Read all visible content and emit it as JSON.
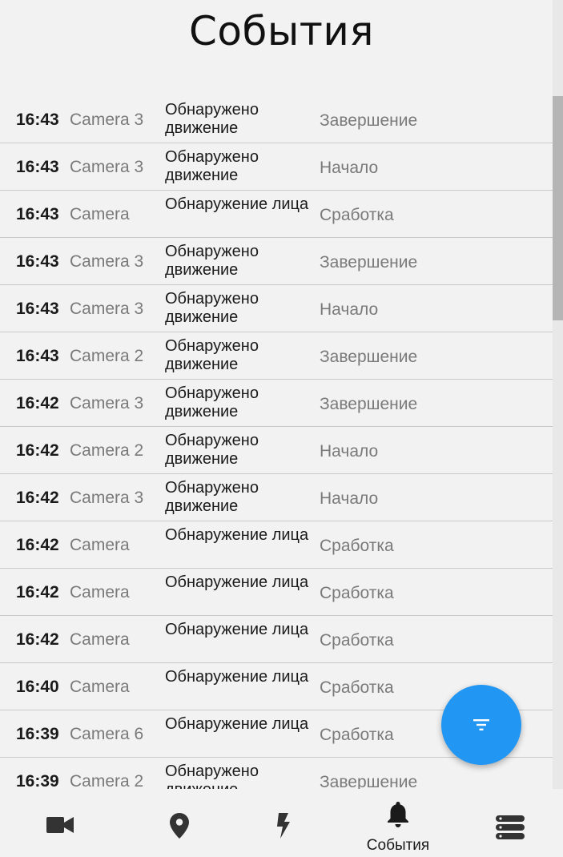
{
  "page": {
    "title": "События"
  },
  "events": [
    {
      "time": "16:43",
      "camera": "Camera 3",
      "type": "Обнаружено движение",
      "status": "Завершение"
    },
    {
      "time": "16:43",
      "camera": "Camera 3",
      "type": "Обнаружено движение",
      "status": "Начало"
    },
    {
      "time": "16:43",
      "camera": "Camera",
      "type": "Обнаружение лица",
      "status": "Сработка"
    },
    {
      "time": "16:43",
      "camera": "Camera 3",
      "type": "Обнаружено движение",
      "status": "Завершение"
    },
    {
      "time": "16:43",
      "camera": "Camera 3",
      "type": "Обнаружено движение",
      "status": "Начало"
    },
    {
      "time": "16:43",
      "camera": "Camera 2",
      "type": "Обнаружено движение",
      "status": "Завершение"
    },
    {
      "time": "16:42",
      "camera": "Camera 3",
      "type": "Обнаружено движение",
      "status": "Завершение"
    },
    {
      "time": "16:42",
      "camera": "Camera 2",
      "type": "Обнаружено движение",
      "status": "Начало"
    },
    {
      "time": "16:42",
      "camera": "Camera 3",
      "type": "Обнаружено движение",
      "status": "Начало"
    },
    {
      "time": "16:42",
      "camera": "Camera",
      "type": "Обнаружение лица",
      "status": "Сработка"
    },
    {
      "time": "16:42",
      "camera": "Camera",
      "type": "Обнаружение лица",
      "status": "Сработка"
    },
    {
      "time": "16:42",
      "camera": "Camera",
      "type": "Обнаружение лица",
      "status": "Сработка"
    },
    {
      "time": "16:40",
      "camera": "Camera",
      "type": "Обнаружение лица",
      "status": "Сработка"
    },
    {
      "time": "16:39",
      "camera": "Camera 6",
      "type": "Обнаружение лица",
      "status": "Сработка"
    },
    {
      "time": "16:39",
      "camera": "Camera 2",
      "type": "Обнаружено движение",
      "status": "Завершение"
    }
  ],
  "fab": {
    "icon": "filter-icon"
  },
  "bottom_nav": {
    "items": [
      {
        "icon": "video-camera-icon",
        "label": ""
      },
      {
        "icon": "map-pin-icon",
        "label": ""
      },
      {
        "icon": "lightning-icon",
        "label": ""
      },
      {
        "icon": "bell-icon",
        "label": "События"
      },
      {
        "icon": "server-icon",
        "label": ""
      }
    ]
  },
  "colors": {
    "background": "#f2f2f2",
    "accent": "#2196f3",
    "divider": "#c9c9c9",
    "secondary_text": "#7a7a7a",
    "primary_text": "#1a1a1a",
    "nav_icon": "#333333"
  }
}
